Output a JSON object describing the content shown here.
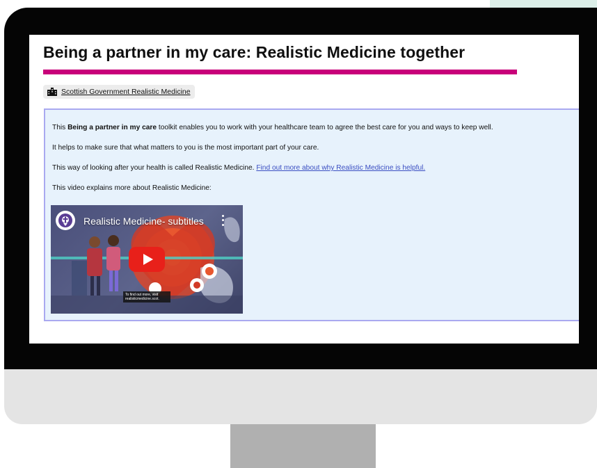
{
  "page": {
    "title": "Being a partner in my care: Realistic Medicine together"
  },
  "source": {
    "label": "Scottish Government Realistic Medicine",
    "icon": "building-icon"
  },
  "content": {
    "p1_prefix": "This ",
    "p1_bold": "Being a partner in my care",
    "p1_suffix": " toolkit enables you to work with your healthcare team to agree the best care for you and ways to keep well.",
    "p2": "It helps to make sure that what matters to you is the most important part of your care.",
    "p3_text": "This way of looking after your health is called Realistic Medicine. ",
    "p3_link": "Find out more about why Realistic Medicine is helpful.",
    "p4": "This video explains more about Realistic Medicine:"
  },
  "video": {
    "title": "Realistic Medicine- subtitles",
    "caption": "To find out more, visit realisticmedicine.scot.",
    "play_icon": "play-icon",
    "menu_icon": "more-vertical-icon"
  },
  "colors": {
    "accent_rule": "#c8007a",
    "box_border": "#a9a9f0",
    "box_bg": "#e7f2fc",
    "link": "#3a4ec2",
    "youtube_red": "#e8201a"
  }
}
